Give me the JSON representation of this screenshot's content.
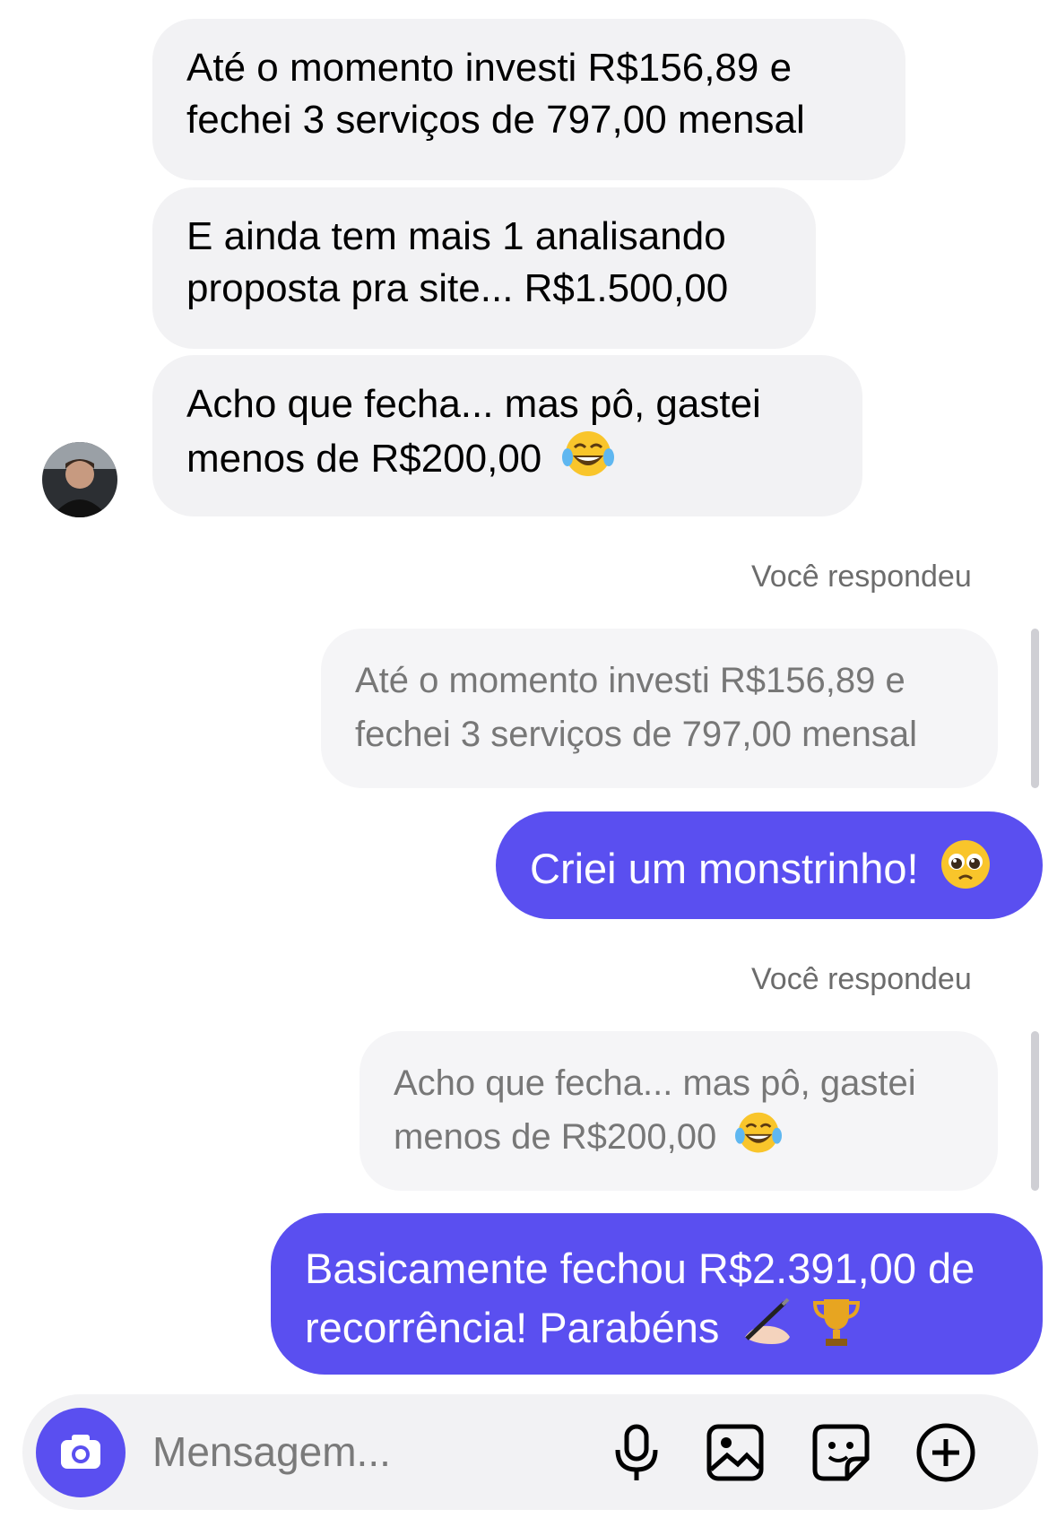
{
  "thread": {
    "incoming": [
      {
        "lines": [
          "Até o momento investi R$156,89 e",
          "fechei 3 serviços de 797,00 mensal"
        ]
      },
      {
        "lines": [
          "E ainda tem mais 1 analisando",
          "proposta pra site... R$1.500,00"
        ]
      },
      {
        "lines": [
          "Acho que fecha... mas pô, gastei",
          "menos de R$200,00"
        ],
        "emoji": "laughing-tears"
      }
    ],
    "replies": [
      {
        "label": "Você respondeu",
        "quote_lines": [
          "Até o momento investi R$156,89 e",
          "fechei 3 serviços de 797,00 mensal"
        ],
        "reply_lines": [
          "Criei um monstrinho!"
        ],
        "reply_emoji": "pleading-face"
      },
      {
        "label": "Você respondeu",
        "quote_lines": [
          "Acho que fecha... mas pô, gastei",
          "menos de R$200,00"
        ],
        "quote_emoji": "laughing-tears",
        "reply_lines": [
          "Basicamente fechou R$2.391,00 de",
          "recorrência! Parabéns"
        ],
        "reply_emoji": [
          "writing-hand",
          "trophy"
        ]
      }
    ]
  },
  "composer": {
    "placeholder": "Mensagem...",
    "icons": [
      "camera-icon",
      "microphone-icon",
      "gallery-icon",
      "sticker-icon",
      "plus-icon"
    ]
  },
  "colors": {
    "accent": "#5a4ff0",
    "incoming_bubble": "#f2f2f4",
    "quote_text": "#777777",
    "meta_text": "#6c6c6c"
  }
}
